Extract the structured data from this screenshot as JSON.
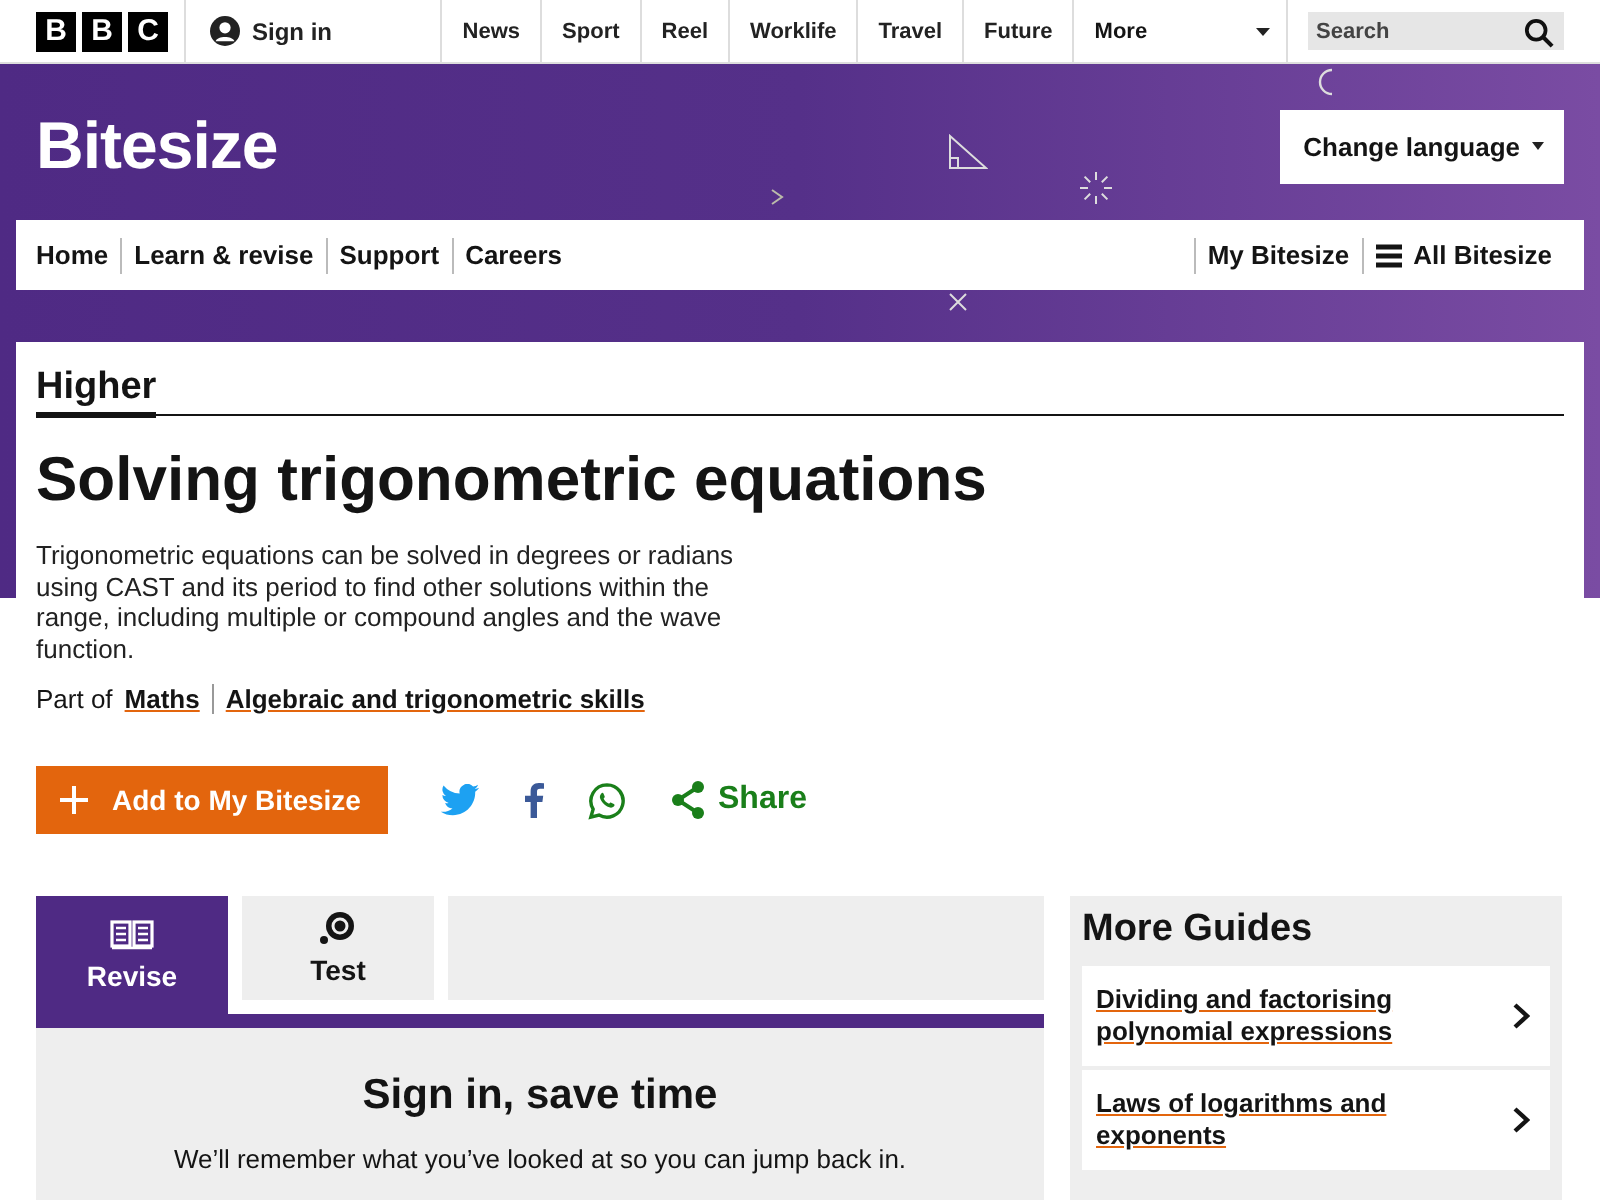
{
  "top_bar": {
    "logo_letters": [
      "B",
      "B",
      "C"
    ],
    "sign_in": "Sign in",
    "nav": [
      "News",
      "Sport",
      "Reel",
      "Worklife",
      "Travel",
      "Future"
    ],
    "more": "More",
    "search": {
      "placeholder": "Search"
    }
  },
  "banner": {
    "title": "Bitesize",
    "change_language": "Change language",
    "nav": [
      "Home",
      "Learn & revise",
      "Support",
      "Careers"
    ],
    "my_bitesize": "My Bitesize",
    "all_bitesize": "All Bitesize"
  },
  "guide": {
    "level": "Higher",
    "title": "Solving trigonometric equations",
    "description": "Trigonometric equations can be solved in degrees or radians using CAST and its period to find other solutions within the range, including multiple or compound angles and the wave function.",
    "part_of": "Part of",
    "links": [
      "Maths",
      "Algebraic and trigonometric skills"
    ],
    "add_button": "Add to My Bitesize",
    "share": "Share"
  },
  "tabs": [
    {
      "kind": "revise",
      "label": "Revise",
      "selected": true
    },
    {
      "kind": "test",
      "label": "Test",
      "selected": false
    }
  ],
  "sign_in_panel": {
    "heading": "Sign in, save time",
    "text": "We’ll remember what you’ve looked at so you can jump back in."
  },
  "more_guides": {
    "heading": "More Guides",
    "items": [
      "Dividing and factorising polynomial expressions",
      "Laws of logarithms and exponents"
    ]
  }
}
